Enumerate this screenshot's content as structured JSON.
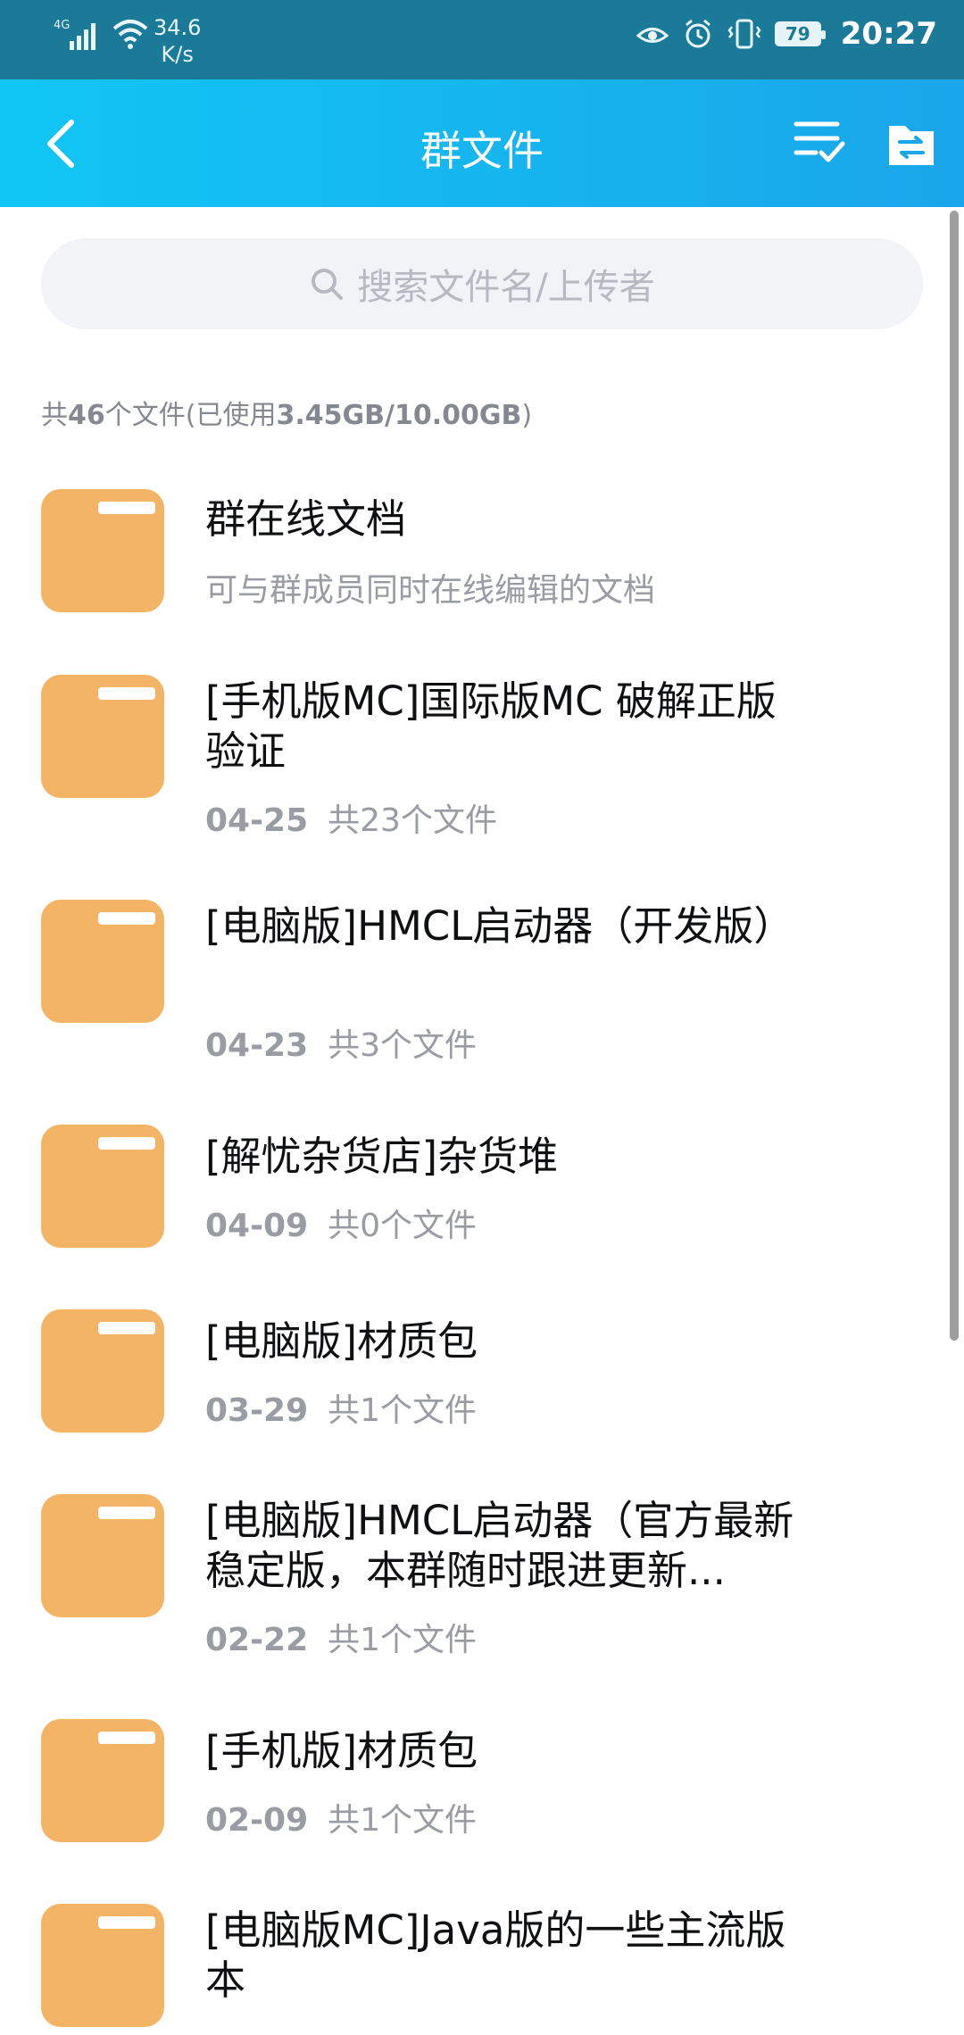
{
  "status_bar": {
    "network": "4G",
    "speed_value": "34.6",
    "speed_unit": "K/s",
    "battery": "79",
    "time": "20:27"
  },
  "header": {
    "title": "群文件",
    "back_icon": "chevron-left-icon",
    "sort_icon": "list-check-icon",
    "files_icon": "folder-transfer-icon"
  },
  "search": {
    "placeholder": "搜索文件名/上传者"
  },
  "summary": {
    "prefix": "共",
    "count": "46",
    "mid": "个文件(已使用",
    "used": "3.45GB",
    "sep": "/",
    "total": "10.00GB",
    "suffix": ")"
  },
  "items": [
    {
      "title": "群在线文档",
      "subtitle": "可与群成员同时在线编辑的文档"
    },
    {
      "title": "[手机版MC]国际版MC 破解正版验证",
      "date": "04-25",
      "count": "共23个文件"
    },
    {
      "title": "[电脑版]HMCL启动器（开发版）",
      "date": "04-23",
      "count": "共3个文件"
    },
    {
      "title": "[解忧杂货店]杂货堆",
      "date": "04-09",
      "count": "共0个文件"
    },
    {
      "title": "[电脑版]材质包",
      "date": "03-29",
      "count": "共1个文件"
    },
    {
      "title": "[电脑版]HMCL启动器（官方最新稳定版，本群随时跟进更新...",
      "date": "02-22",
      "count": "共1个文件"
    },
    {
      "title": "[手机版]材质包",
      "date": "02-09",
      "count": "共1个文件"
    },
    {
      "title": "[电脑版MC]Java版的一些主流版本",
      "date": "",
      "count": ""
    }
  ],
  "colors": {
    "header_start": "#11c6f4",
    "header_end": "#1aa6ea",
    "statusbar": "#1a7a98",
    "folder": "#f4b465"
  }
}
